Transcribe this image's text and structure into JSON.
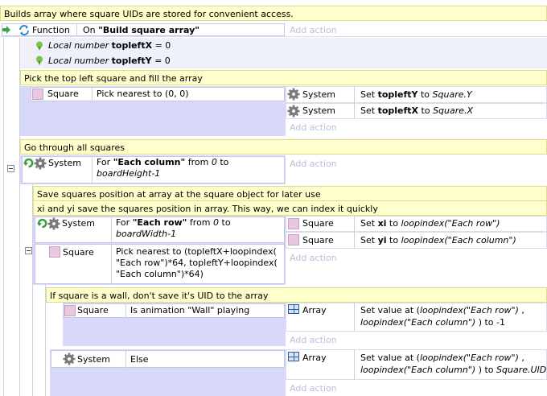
{
  "comments": {
    "top": "Builds array where square UIDs are stored for convenient access.",
    "pick": "Pick the top left square and fill the array",
    "go": "Go through all squares",
    "save1": "Save squares position at array at the square object for later use",
    "save2": "xi and yi save the squares position in array. This way, we can index it quickly",
    "wall": "If square is a wall, don't save it's UID to the array"
  },
  "function_row": {
    "label": "Function",
    "on_prefix": "On ",
    "name": "\"Build square array\"",
    "add_action": "Add action"
  },
  "locals": [
    {
      "prefix": "Local number ",
      "name": "topleftX",
      "value": " = 0"
    },
    {
      "prefix": "Local number ",
      "name": "topleftY",
      "value": " = 0"
    }
  ],
  "block1": {
    "object": "Square",
    "condition": "Pick nearest to (0, 0)",
    "actions": [
      {
        "object": "System",
        "pre": "Set ",
        "var": "topleftY",
        "mid": " to ",
        "val": "Square.Y"
      },
      {
        "object": "System",
        "pre": "Set ",
        "var": "topleftX",
        "mid": " to ",
        "val": "Square.X"
      }
    ],
    "add_action": "Add action"
  },
  "block2": {
    "object": "System",
    "for_prefix": "For ",
    "for_name": "\"Each column\"",
    "from": " from ",
    "start": "0",
    "to": " to ",
    "end": "boardHeight-1",
    "add_action": "Add action"
  },
  "block3": {
    "cond1_object": "System",
    "for_prefix": "For ",
    "for_name": "\"Each row\"",
    "from": " from ",
    "start": "0",
    "to": " to ",
    "end": "boardWidth-1",
    "cond2_object": "Square",
    "cond2_text": "Pick nearest to (topleftX+loopindex( \"Each row\")*64, topleftY+loopindex( \"Each column\")*64)",
    "actions": [
      {
        "object": "Square",
        "pre": "Set ",
        "var": "xi",
        "mid": " to ",
        "val": "loopindex(\"Each row\")"
      },
      {
        "object": "Square",
        "pre": "Set ",
        "var": "yi",
        "mid": " to ",
        "val": "loopindex(\"Each column\")"
      }
    ],
    "add_action": "Add action"
  },
  "block4": {
    "object": "Square",
    "condition": "Is animation \"Wall\" playing",
    "action_object": "Array",
    "action_pre": "Set value at (",
    "action_l1": "loopindex(\"Each row\")",
    "action_l1_suffix": " ,",
    "action_l2": "loopindex(\"Each column\")",
    "action_l2_suffix": " ) to -1",
    "add_action": "Add action"
  },
  "block5": {
    "object": "System",
    "condition": "Else",
    "action_object": "Array",
    "action_pre": "Set value at (",
    "action_l1": "loopindex(\"Each row\")",
    "action_l1_suffix": " ,",
    "action_l2": "loopindex(\"Each column\")",
    "action_l2_suffix": " ) to ",
    "action_l2_val": "Square.UID",
    "add_action": "Add action"
  },
  "colors": {
    "comment_bg": "#ffffcc",
    "event_bg": "#d8d8f8",
    "loop_green": "#38a045",
    "muted_text": "#b9bfd8"
  }
}
